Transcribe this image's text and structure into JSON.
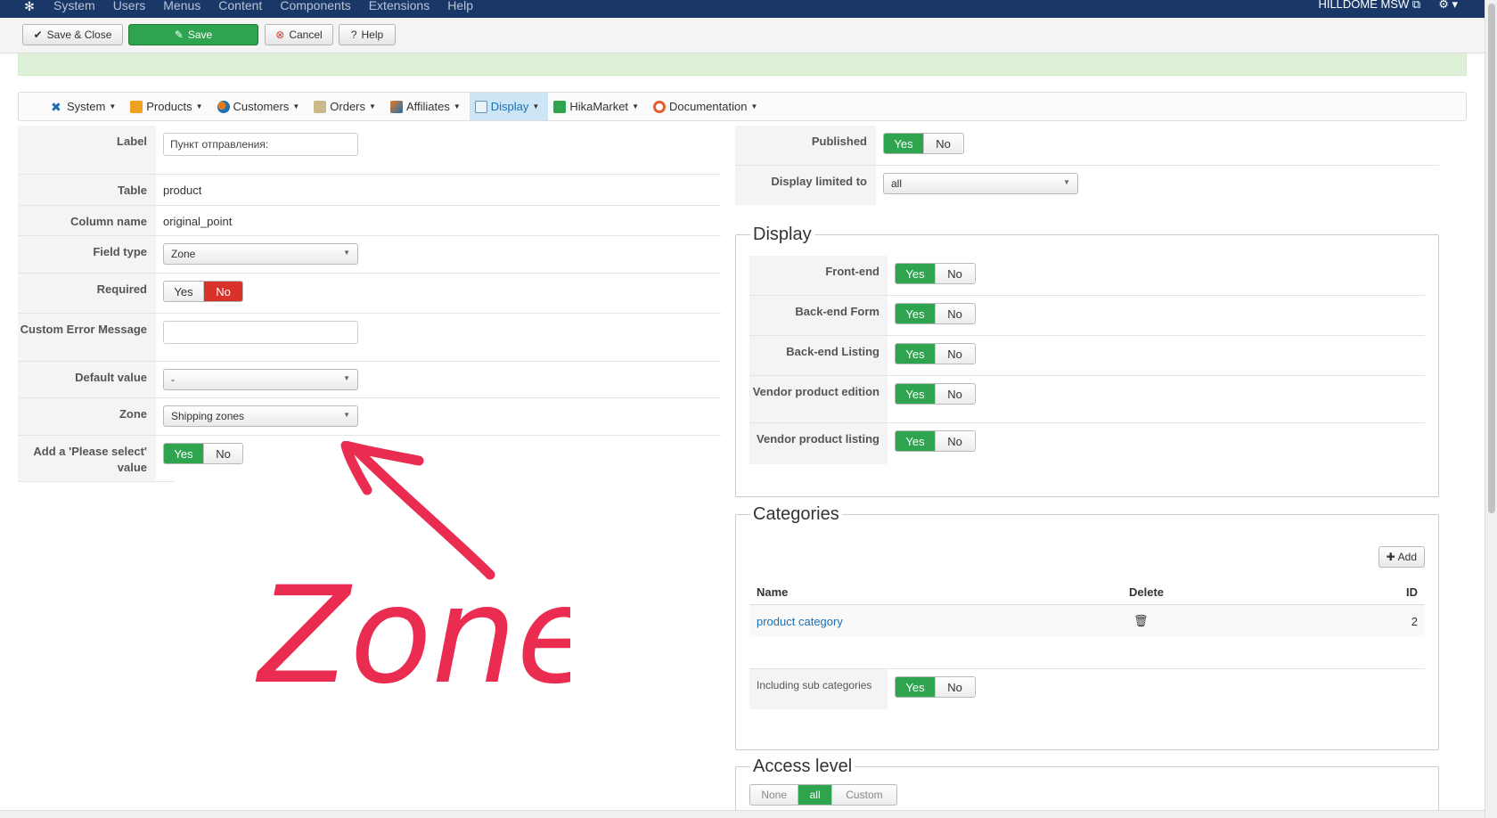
{
  "topnav": {
    "menu": [
      "System",
      "Users",
      "Menus",
      "Content",
      "Components",
      "Extensions",
      "Help"
    ],
    "user": "HILLDOME MSW"
  },
  "toolbar": {
    "save_close": "Save & Close",
    "save": "Save",
    "cancel": "Cancel",
    "help": "Help"
  },
  "hikamenu": {
    "items": [
      "System",
      "Products",
      "Customers",
      "Orders",
      "Affiliates",
      "Display",
      "HikaMarket",
      "Documentation"
    ],
    "active": "Display"
  },
  "form": {
    "label_lbl": "Label",
    "label_val": "Пункт отправления:",
    "table_lbl": "Table",
    "table_val": "product",
    "column_lbl": "Column name",
    "column_val": "original_point",
    "fieldtype_lbl": "Field type",
    "fieldtype_val": "Zone",
    "required_lbl": "Required",
    "custom_error_lbl": "Custom Error Message",
    "default_lbl": "Default value",
    "default_val": "-",
    "zone_lbl": "Zone",
    "zone_val": "Shipping zones",
    "please_select_lbl": "Add a 'Please select' value"
  },
  "toggle": {
    "yes": "Yes",
    "no": "No"
  },
  "right": {
    "published_lbl": "Published",
    "display_limited_lbl": "Display limited to",
    "display_limited_val": "all",
    "display_legend": "Display",
    "frontend_lbl": "Front-end",
    "backend_form_lbl": "Back-end Form",
    "backend_listing_lbl": "Back-end Listing",
    "vendor_edition_lbl": "Vendor product edition",
    "vendor_listing_lbl": "Vendor product listing",
    "categories_legend": "Categories",
    "add_label": "Add",
    "col_name": "Name",
    "col_delete": "Delete",
    "col_id": "ID",
    "cat_name": "product category",
    "cat_id": "2",
    "including_sub_lbl": "Including sub categories",
    "access_legend": "Access level",
    "access_none": "None",
    "access_all": "all",
    "access_custom": "Custom"
  },
  "annotation_text": "Zone"
}
